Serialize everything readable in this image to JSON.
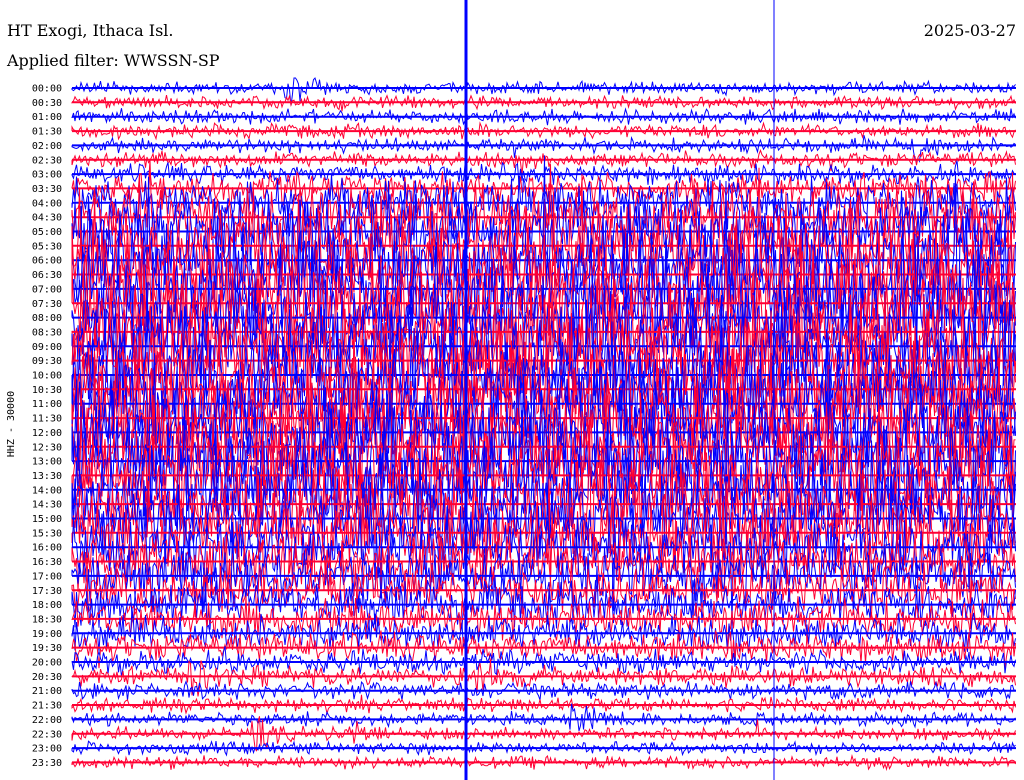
{
  "chart_data": {
    "type": "line",
    "title": "HT Exogi, Ithaca Isl.",
    "subtitle": "Applied filter: WWSSN-SP",
    "date": "2025-03-27",
    "ylabel": "HHZ - 30000",
    "xlabel": "",
    "series_colors": [
      "#0000ff",
      "#ff0033"
    ],
    "grid": false,
    "legend": "none",
    "row_labels": [
      "00:00",
      "00:30",
      "01:00",
      "01:30",
      "02:00",
      "02:30",
      "03:00",
      "03:30",
      "04:00",
      "04:30",
      "05:00",
      "05:30",
      "06:00",
      "06:30",
      "07:00",
      "07:30",
      "08:00",
      "08:30",
      "09:00",
      "09:30",
      "10:00",
      "10:30",
      "11:00",
      "11:30",
      "12:00",
      "12:30",
      "13:00",
      "13:30",
      "14:00",
      "14:30",
      "15:00",
      "15:30",
      "16:00",
      "16:30",
      "17:00",
      "17:30",
      "18:00",
      "18:30",
      "19:00",
      "19:30",
      "20:00",
      "20:30",
      "21:00",
      "21:30",
      "22:00",
      "22:30",
      "23:00",
      "23:30"
    ],
    "row_activity": [
      0.1,
      0.1,
      0.12,
      0.12,
      0.12,
      0.14,
      0.18,
      0.3,
      0.5,
      0.65,
      0.8,
      0.9,
      0.95,
      1.0,
      1.0,
      1.0,
      1.0,
      1.0,
      1.0,
      1.0,
      1.0,
      1.0,
      1.0,
      1.0,
      1.0,
      1.0,
      1.0,
      1.0,
      0.95,
      0.9,
      0.85,
      0.8,
      0.7,
      0.6,
      0.55,
      0.5,
      0.45,
      0.4,
      0.35,
      0.28,
      0.22,
      0.18,
      0.15,
      0.12,
      0.12,
      0.1,
      0.1,
      0.1
    ],
    "events": [
      {
        "row": "00:00",
        "minute": 7
      },
      {
        "row": "02:00",
        "minute": 27
      },
      {
        "row": "04:00",
        "minute": 11
      },
      {
        "row": "20:30",
        "minute": 4
      },
      {
        "row": "20:30",
        "minute": 13
      },
      {
        "row": "22:00",
        "minute": 16
      },
      {
        "row": "22:30",
        "minute": 6
      },
      {
        "row": "22:30",
        "minute": 9
      }
    ]
  }
}
